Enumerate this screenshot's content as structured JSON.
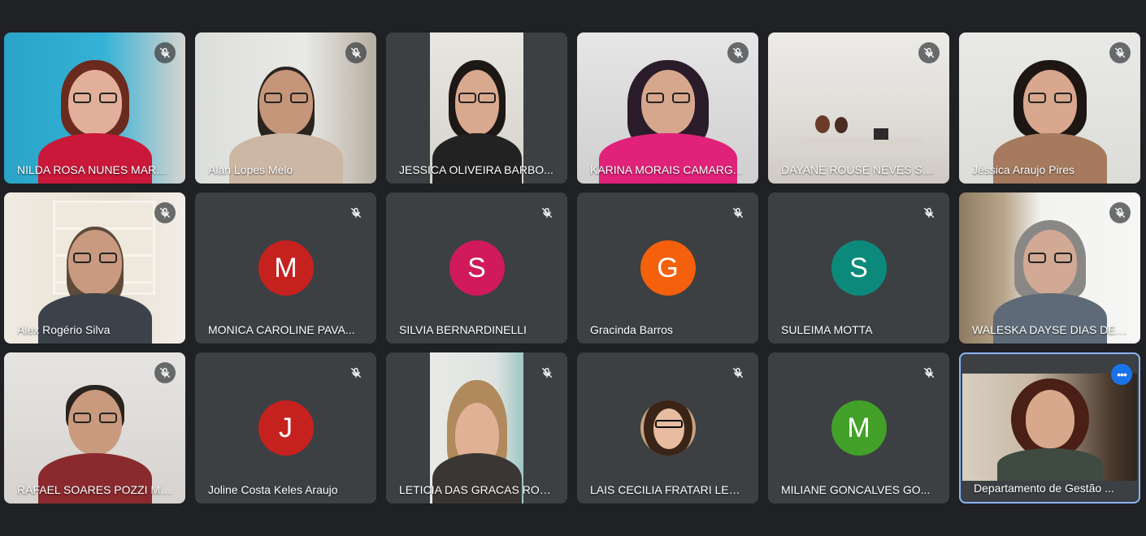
{
  "colors": {
    "background": "#202124",
    "tile": "#3c4043",
    "self_border": "#8ab4f8",
    "more_button": "#1a73e8"
  },
  "participants": [
    {
      "name": "NILDA ROSA NUNES MARTI...",
      "muted": true
    },
    {
      "name": "Alan Lopes Melo",
      "muted": true
    },
    {
      "name": "JESSICA OLIVEIRA BARBO...",
      "muted": false
    },
    {
      "name": "KARINA MORAIS CAMARG...",
      "muted": true
    },
    {
      "name": "DAYANE ROUSE NEVES SO...",
      "muted": true
    },
    {
      "name": "Jéssica Araujo Pires",
      "muted": true
    },
    {
      "name": "Alex Rogério Silva",
      "muted": true
    },
    {
      "name": "MONICA CAROLINE PAVA...",
      "muted": true,
      "initial": "M",
      "avatar_color": "#c5221f"
    },
    {
      "name": "SILVIA BERNARDINELLI",
      "muted": true,
      "initial": "S",
      "avatar_color": "#d01a5a"
    },
    {
      "name": "Gracinda Barros",
      "muted": true,
      "initial": "G",
      "avatar_color": "#f4600c"
    },
    {
      "name": "SULEIMA MOTTA",
      "muted": true,
      "initial": "S",
      "avatar_color": "#0b8a7b"
    },
    {
      "name": "WALESKA DAYSE DIAS DE ...",
      "muted": true
    },
    {
      "name": "RAFAEL SOARES POZZI MA...",
      "muted": true
    },
    {
      "name": "Joline Costa Keles Araujo",
      "muted": true,
      "initial": "J",
      "avatar_color": "#c5221f"
    },
    {
      "name": "LETICIA DAS GRACAS ROS...",
      "muted": true
    },
    {
      "name": "LAIS CECILIA FRATARI LEA...",
      "muted": true
    },
    {
      "name": "MILIANE GONCALVES GO...",
      "muted": true,
      "initial": "M",
      "avatar_color": "#43a028"
    },
    {
      "name": "Departamento de Gestão ...",
      "muted": false,
      "self": true
    }
  ],
  "icons": {
    "mute": "mic-off-icon",
    "more": "more-options-icon"
  }
}
